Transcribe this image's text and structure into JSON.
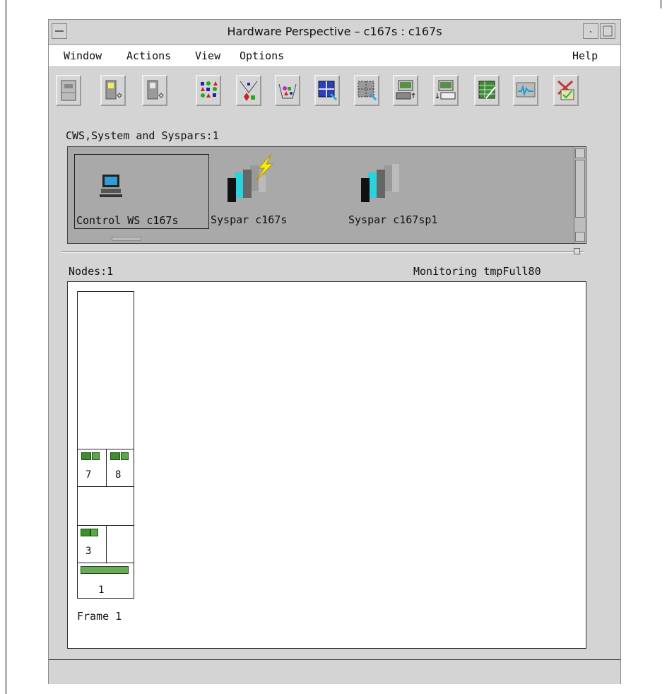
{
  "window": {
    "title": "Hardware Perspective – c167s : c167s"
  },
  "menu": {
    "items": [
      "Window",
      "Actions",
      "View",
      "Options"
    ],
    "help": "Help"
  },
  "toolbar": {
    "buttons": [
      "notebook-icon",
      "node-light-icon",
      "node-dim-icon",
      "shapes-grid-icon",
      "shapes-filter-icon",
      "shapes-basket-icon",
      "grid-select-icon",
      "grid-dotted-select-icon",
      "terminal-up-icon",
      "terminal-down-icon",
      "table-edit-icon",
      "monitor-graph-icon",
      "close-check-icon"
    ]
  },
  "systems": {
    "header": "CWS,System and Syspars:1",
    "items": [
      {
        "label": "Control WS c167s",
        "icon": "workstation-icon",
        "selected": true
      },
      {
        "label": "Syspar c167s",
        "icon": "syspar-active-icon",
        "selected": false
      },
      {
        "label": "Syspar c167sp1",
        "icon": "syspar-icon",
        "selected": false
      }
    ]
  },
  "nodes": {
    "header": "Nodes:1",
    "monitoring": "Monitoring tmpFull80",
    "frame_label": "Frame 1",
    "slots": [
      {
        "number": "7"
      },
      {
        "number": "8"
      },
      {
        "number": "3"
      },
      {
        "number": "1"
      }
    ]
  },
  "colors": {
    "node_green": "#3d8f2e",
    "panel_gray": "#a9a9a9",
    "window_gray": "#d4d4d4"
  }
}
